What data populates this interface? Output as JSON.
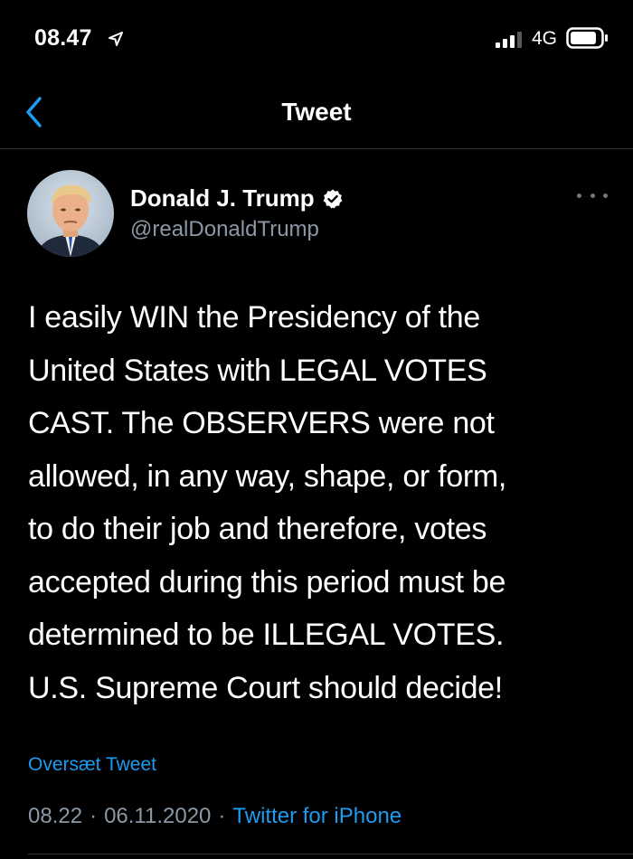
{
  "status_bar": {
    "time": "08.47",
    "network": "4G",
    "icons": [
      "location-arrow-icon",
      "signal-bars-icon",
      "battery-icon"
    ]
  },
  "header": {
    "title": "Tweet",
    "back_icon": "chevron-left-icon"
  },
  "tweet": {
    "author_name": "Donald J. Trump",
    "author_handle": "@realDonaldTrump",
    "verified_icon": "verified-badge-icon",
    "more_icon": "more-dots-icon",
    "text": "I easily WIN the Presidency of the\nUnited States with LEGAL VOTES\nCAST. The OBSERVERS were not\nallowed, in any way, shape, or form,\nto do their job and therefore, votes\naccepted during this period must be\ndetermined to be ILLEGAL VOTES.\nU.S. Supreme Court should decide!",
    "translate_label": "Oversæt Tweet",
    "time": "08.22",
    "date": "06.11.2020",
    "separator": "·",
    "source": "Twitter for iPhone"
  },
  "colors": {
    "background": "#000000",
    "text": "#ffffff",
    "secondary_text": "#8b98a5",
    "accent": "#1d9bf0",
    "divider": "#2f3336"
  }
}
